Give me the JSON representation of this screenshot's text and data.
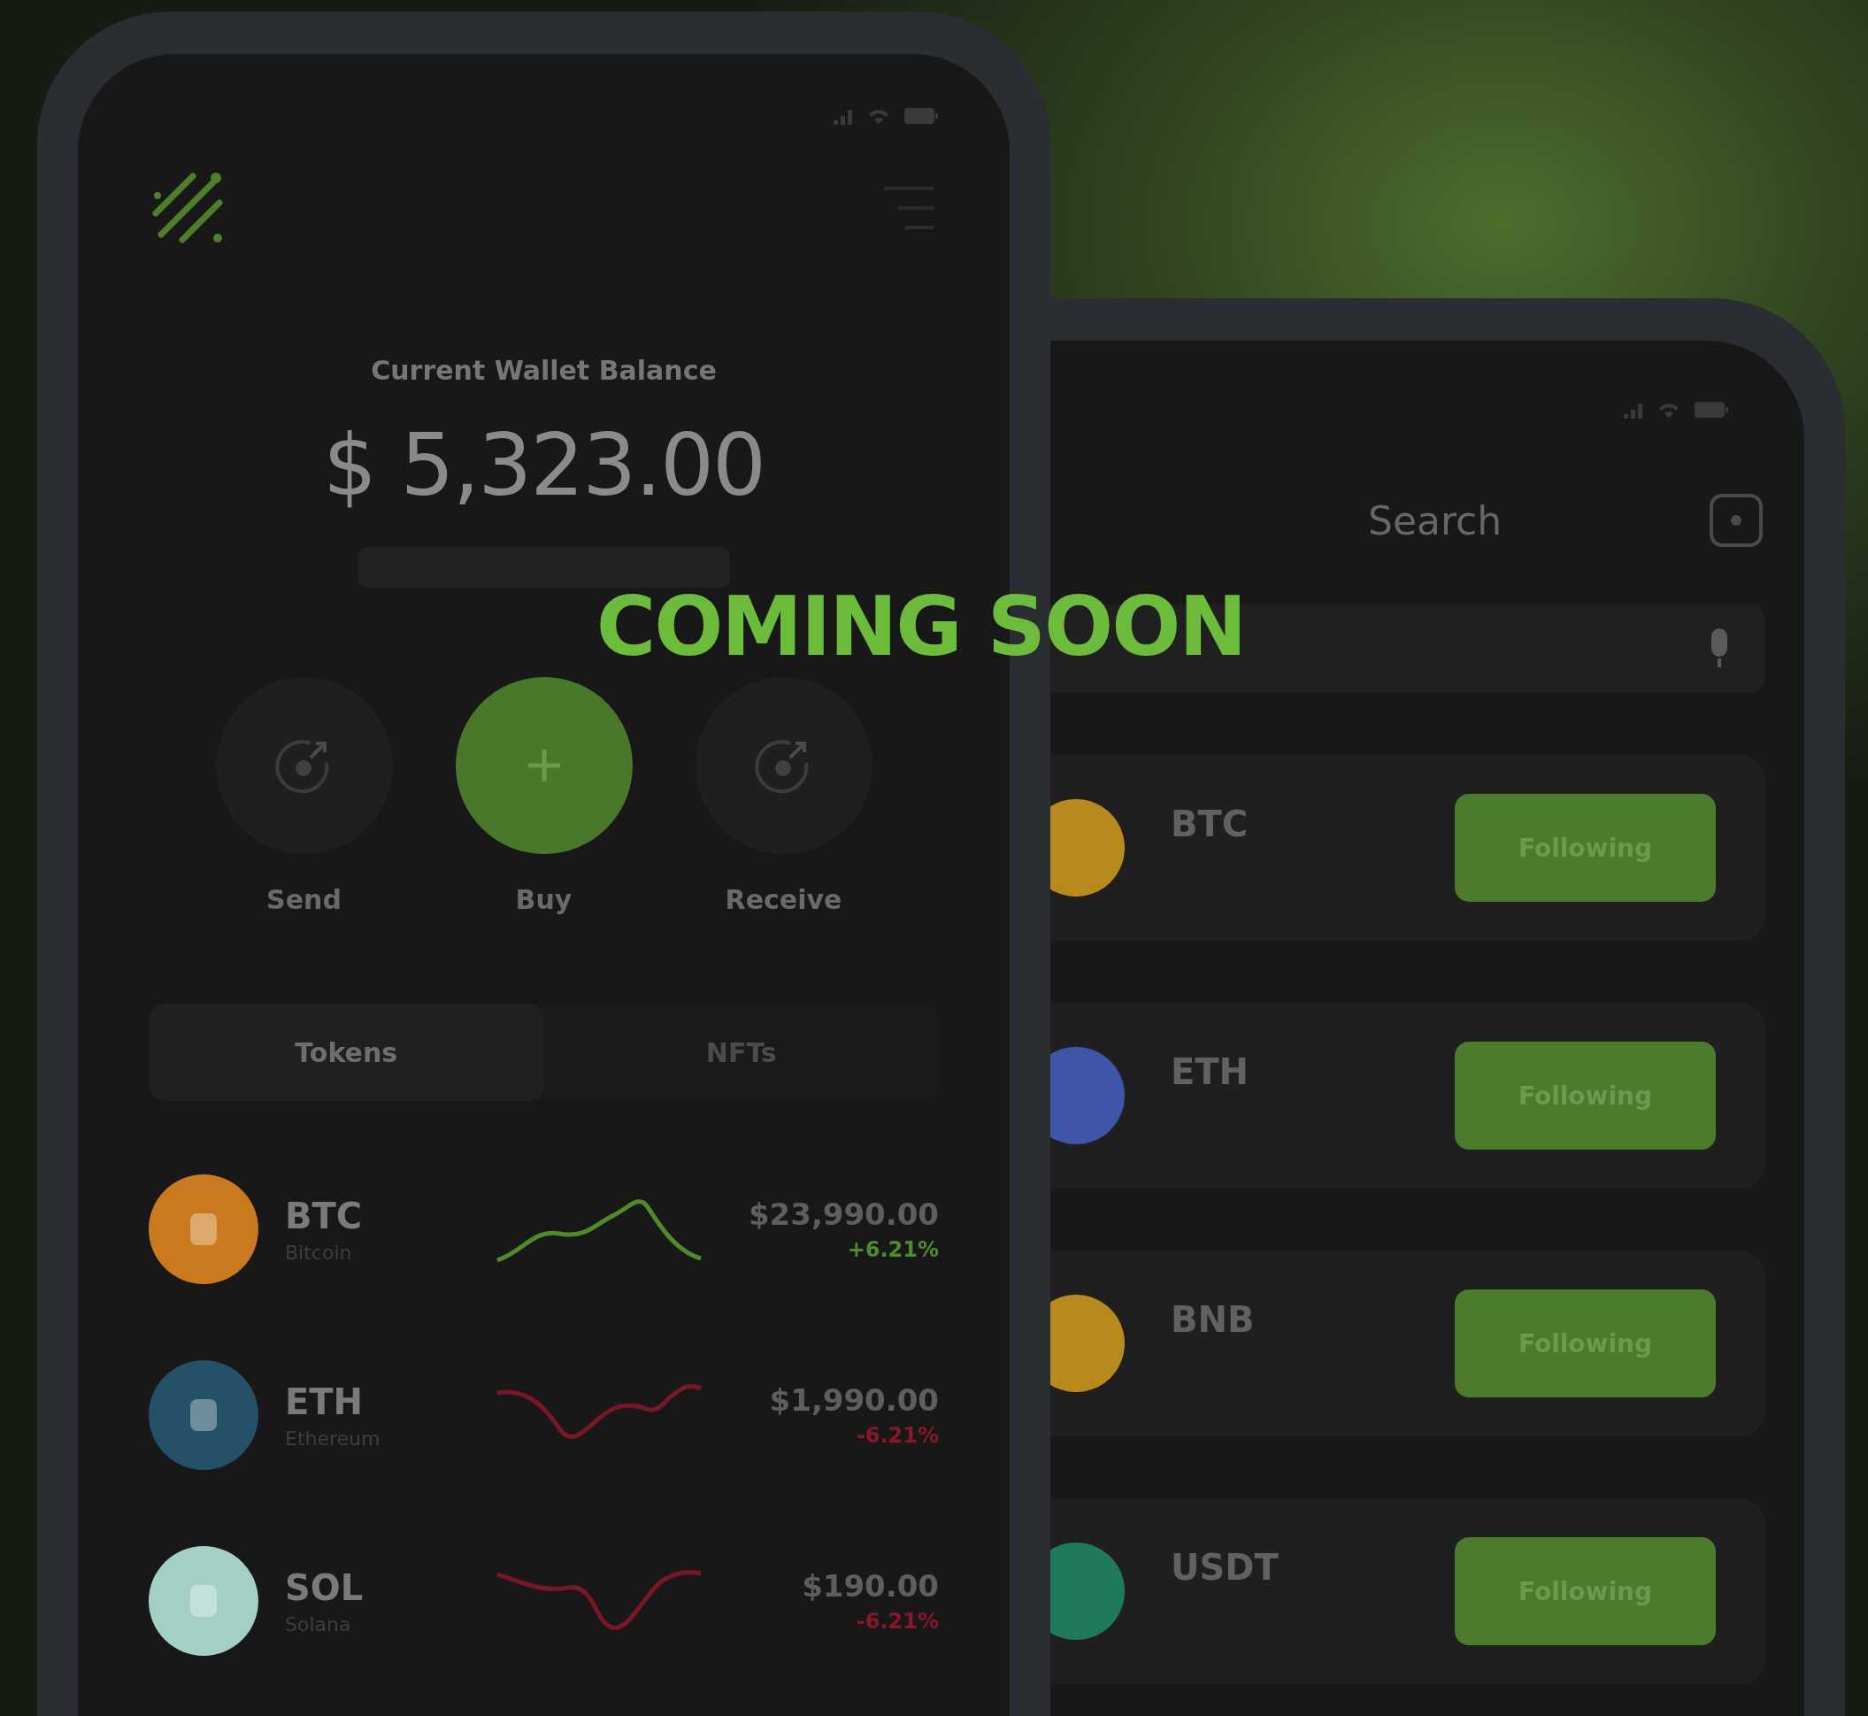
{
  "banner": "COMING SOON",
  "home": {
    "balance_label": "Current Wallet Balance",
    "balance": "$ 5,323.00",
    "actions": [
      {
        "label": "Send",
        "kind": "send"
      },
      {
        "label": "Buy",
        "kind": "buy"
      },
      {
        "label": "Receive",
        "kind": "receive"
      }
    ],
    "tabs": [
      {
        "label": "Tokens",
        "selected": true
      },
      {
        "label": "NFTs",
        "selected": false
      }
    ],
    "tokens": [
      {
        "symbol": "BTC",
        "name": "Bitcoin",
        "price": "$23,990.00",
        "change": "+6.21%",
        "kind": "rising",
        "color": "#c97a1f"
      },
      {
        "symbol": "ETH",
        "name": "Ethereum",
        "price": "$1,990.00",
        "change": "-6.21%",
        "kind": "falling",
        "color": "#245068"
      },
      {
        "symbol": "SOL",
        "name": "Solana",
        "price": "$190.00",
        "change": "-6.21%",
        "kind": "falling",
        "color": "#a3cfc6"
      }
    ]
  },
  "search": {
    "title": "Search",
    "coins": [
      {
        "symbol": "BTC",
        "button": "Following",
        "color": "#b8891c"
      },
      {
        "symbol": "ETH",
        "button": "Following",
        "color": "#3f56a8"
      },
      {
        "symbol": "BNB",
        "button": "Following",
        "color": "#b8891c"
      },
      {
        "symbol": "USDT",
        "button": "Following",
        "color": "#1f7a5a"
      }
    ]
  }
}
